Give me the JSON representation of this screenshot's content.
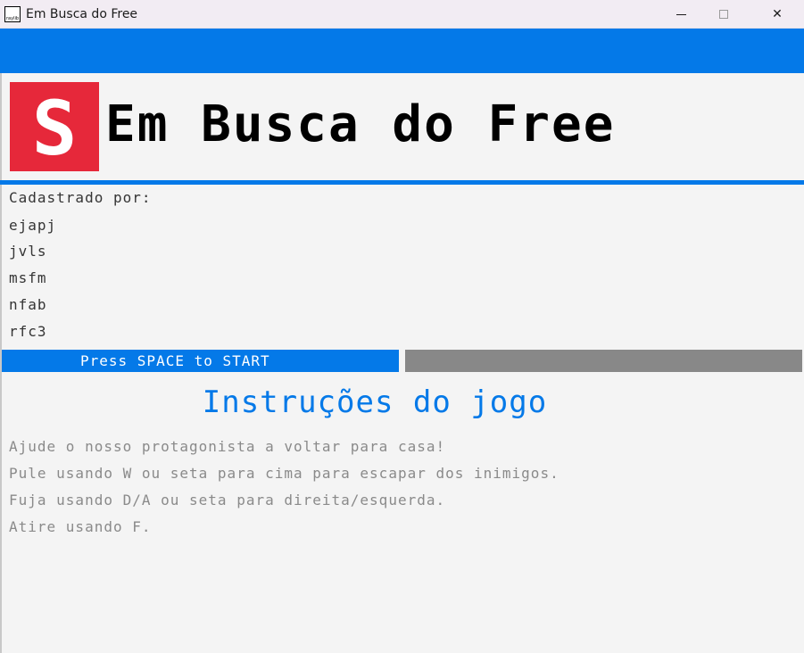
{
  "window": {
    "title": "Em Busca do Free",
    "icon_text": "raylib",
    "controls": {
      "minimize": "minimize-icon",
      "maximize": "maximize-icon",
      "close": "✕"
    }
  },
  "header": {
    "logo_letter": "S",
    "title": "Em Busca do Free"
  },
  "credits": {
    "label": "Cadastrado por:",
    "names": [
      "ejapj",
      "jvls",
      "msfm",
      "nfab",
      "rfc3"
    ]
  },
  "start": {
    "label": "Press SPACE to START",
    "progress": 0
  },
  "instructions": {
    "title": "Instruções do jogo",
    "lines": [
      "Ajude o nosso protagonista a voltar para casa!",
      "Pule usando W ou seta para cima para escapar dos inimigos.",
      "Fuja usando D/A ou seta para direita/esquerda.",
      "Atire usando F."
    ]
  },
  "colors": {
    "accent_blue": "#0479e8",
    "logo_red": "#e6283a",
    "background": "#f4f4f4",
    "track_gray": "#888888"
  }
}
